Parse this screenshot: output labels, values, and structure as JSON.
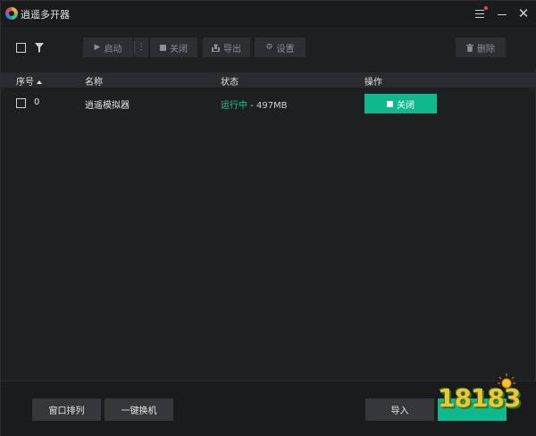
{
  "window": {
    "title": "逍遥多开器"
  },
  "titlebar": {
    "menu_icon": "hamburger-menu-icon",
    "minimize_icon": "minimize-icon",
    "close_glyph": "✕"
  },
  "toolbar": {
    "select_all_icon": "checkbox-icon",
    "filter_icon": "funnel-icon",
    "start_label": "启动",
    "more_glyph": "⋮",
    "close_label": "关闭",
    "export_label": "导出",
    "settings_label": "设置",
    "delete_label": "删除"
  },
  "table": {
    "columns": [
      "序号",
      "名称",
      "状态",
      "操作"
    ],
    "rows": [
      {
        "index": "0",
        "name": "逍遥模拟器",
        "status_text": "运行中",
        "status_sep": " - ",
        "memory": "497MB",
        "action_label": "关闭"
      }
    ]
  },
  "bottombar": {
    "arrange_label": "窗口排列",
    "swap_label": "一键换机",
    "import_label": "导入"
  },
  "watermark": {
    "text": "18183"
  },
  "colors": {
    "accent": "#10b88e",
    "running": "#22c493",
    "background": "#1e1f21",
    "toolbar_button": "#2d2e31",
    "header_row": "#2a2b2e"
  }
}
